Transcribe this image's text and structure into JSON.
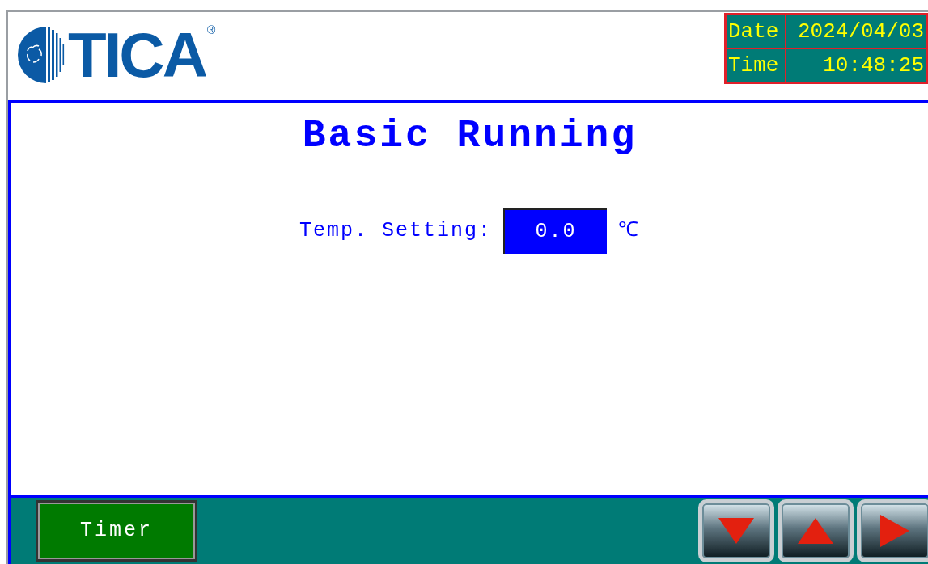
{
  "header": {
    "logo": {
      "text": "TICA",
      "mark": "®"
    },
    "clock": [
      {
        "label": "Date",
        "value": "2024/04/03"
      },
      {
        "label": "Time",
        "value": "10:48:25"
      }
    ]
  },
  "title": "Basic Running",
  "settings": [
    {
      "label": "Temp. Setting:",
      "value": "0.0",
      "unit": "℃"
    }
  ],
  "footer": {
    "buttons": [
      {
        "label": "Timer"
      }
    ],
    "nav_buttons": [
      {
        "kind": "down"
      },
      {
        "kind": "up"
      },
      {
        "kind": "next"
      }
    ]
  }
}
